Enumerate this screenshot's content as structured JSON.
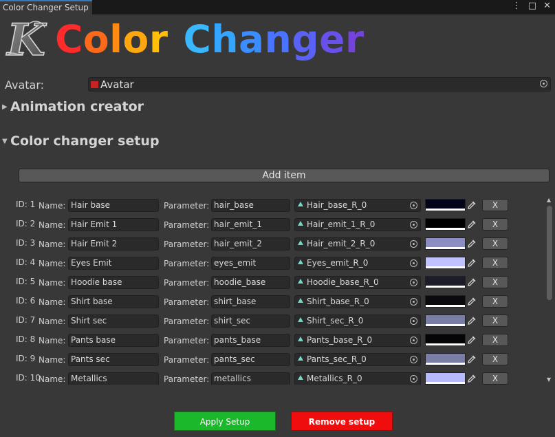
{
  "window": {
    "tab_title": "Color Changer Setup"
  },
  "header": {
    "logo_letter": "K",
    "title_letters": [
      {
        "ch": "C",
        "color": "#ff2b2b"
      },
      {
        "ch": "o",
        "color": "#ff6a1a"
      },
      {
        "ch": "l",
        "color": "#ff8c12"
      },
      {
        "ch": "o",
        "color": "#ffa70e"
      },
      {
        "ch": "r",
        "color": "#ffbf0a"
      },
      {
        "ch": " ",
        "color": "#ffffff"
      },
      {
        "ch": "C",
        "color": "#39b8ff"
      },
      {
        "ch": "h",
        "color": "#34a6ff"
      },
      {
        "ch": "a",
        "color": "#3b8cff"
      },
      {
        "ch": "n",
        "color": "#4a74ff"
      },
      {
        "ch": "g",
        "color": "#5a62f6"
      },
      {
        "ch": "e",
        "color": "#6850ea"
      },
      {
        "ch": "r",
        "color": "#7442dc"
      }
    ]
  },
  "avatar": {
    "label": "Avatar:",
    "value": "Avatar"
  },
  "sections": {
    "animation_creator": "Animation creator",
    "color_changer_setup": "Color changer setup"
  },
  "add_item_label": "Add item",
  "labels": {
    "name": "Name:",
    "parameter": "Parameter:",
    "remove": "X"
  },
  "items": [
    {
      "id": "ID: 1",
      "name": "Hair base",
      "parameter": "hair_base",
      "object": "Hair_base_R_0",
      "color": "#03031a"
    },
    {
      "id": "ID: 2",
      "name": "Hair Emit 1",
      "parameter": "hair_emit_1",
      "object": "Hair_emit_1_R_0",
      "color": "#000000"
    },
    {
      "id": "ID: 3",
      "name": "Hair Emit 2",
      "parameter": "hair_emit_2",
      "object": "Hair_emit_2_R_0",
      "color": "#8c8ec2"
    },
    {
      "id": "ID: 4",
      "name": "Eyes Emit",
      "parameter": "eyes_emit",
      "object": "Eyes_emit_R_0",
      "color": "#c0c2ff"
    },
    {
      "id": "ID: 5",
      "name": "Hoodie base",
      "parameter": "hoodie_base",
      "object": "Hoodie_base_R_0",
      "color": "#1d1d2a"
    },
    {
      "id": "ID: 6",
      "name": "Shirt base",
      "parameter": "shirt_base",
      "object": "Shirt_base_R_0",
      "color": "#0b0b0f"
    },
    {
      "id": "ID: 7",
      "name": "Shirt sec",
      "parameter": "shirt_sec",
      "object": "Shirt_sec_R_0",
      "color": "#7a7ea4"
    },
    {
      "id": "ID: 8",
      "name": "Pants base",
      "parameter": "pants_base",
      "object": "Pants_base_R_0",
      "color": "#050508"
    },
    {
      "id": "ID: 9",
      "name": "Pants sec",
      "parameter": "pants_sec",
      "object": "Pants_sec_R_0",
      "color": "#7a7ea4"
    },
    {
      "id": "ID: 10",
      "name": "Metallics",
      "parameter": "metallics",
      "object": "Metallics_R_0",
      "color": "#b8baff"
    }
  ],
  "footer": {
    "apply": "Apply Setup",
    "remove": "Remove setup"
  }
}
